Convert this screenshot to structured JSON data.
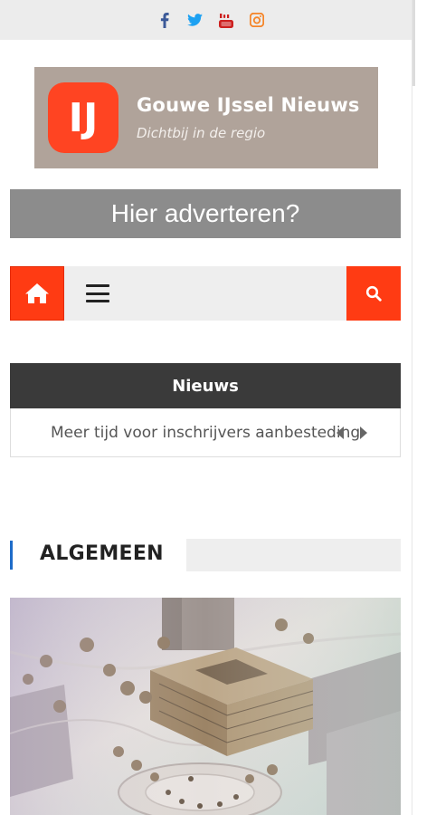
{
  "social": {
    "icons": [
      "facebook-icon",
      "twitter-icon",
      "youtube-icon",
      "instagram-icon"
    ],
    "colors": {
      "facebook": "#3b5998",
      "twitter": "#1da1f2",
      "youtube": "#cd201f",
      "instagram": "#f58529"
    }
  },
  "logo": {
    "mark": "IJ",
    "title": "Gouwe IJssel Nieuws",
    "subtitle": "Dichtbij in de regio",
    "brand_color": "#ff4422",
    "box_color": "#b0a39a"
  },
  "ad": {
    "label": "Hier adverteren?"
  },
  "nav": {
    "home_icon": "home-icon",
    "menu_icon": "hamburger-menu-icon",
    "search_icon": "search-icon",
    "accent": "#ff3b13"
  },
  "ticker": {
    "heading": "Nieuws",
    "headline": "Meer tijd voor inschrijvers aanbesteding"
  },
  "section": {
    "title": "ALGEMEEN",
    "accent": "#1e6cc9"
  }
}
